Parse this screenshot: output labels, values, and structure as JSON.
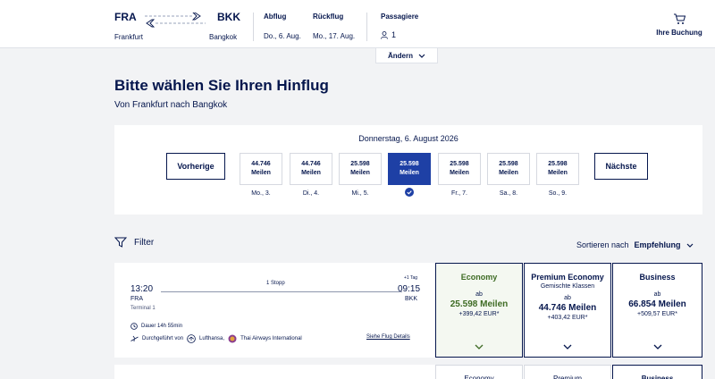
{
  "header": {
    "origin_code": "FRA",
    "origin_city": "Frankfurt",
    "destination_code": "BKK",
    "destination_city": "Bangkok",
    "outbound_label": "Abflug",
    "outbound_date": "Do., 6. Aug.",
    "return_label": "Rückflug",
    "return_date": "Mo., 17. Aug.",
    "passengers_label": "Passagiere",
    "passengers_count": "1",
    "booking_label": "Ihre Buchung",
    "change_label": "Ändern"
  },
  "page": {
    "title": "Bitte wählen Sie Ihren Hinflug",
    "subtitle": "Von Frankfurt nach Bangkok"
  },
  "date_selector": {
    "heading": "Donnerstag, 6. August 2026",
    "prev_label": "Vorherige",
    "next_label": "Nächste",
    "days": [
      {
        "amount": "44.746",
        "unit": "Meilen",
        "label": "Mo., 3."
      },
      {
        "amount": "44.746",
        "unit": "Meilen",
        "label": "Di., 4."
      },
      {
        "amount": "25.598",
        "unit": "Meilen",
        "label": "Mi., 5."
      },
      {
        "amount": "25.598",
        "unit": "Meilen",
        "label": "",
        "selected": true
      },
      {
        "amount": "25.598",
        "unit": "Meilen",
        "label": "Fr., 7."
      },
      {
        "amount": "25.598",
        "unit": "Meilen",
        "label": "Sa., 8."
      },
      {
        "amount": "25.598",
        "unit": "Meilen",
        "label": "So., 9."
      }
    ]
  },
  "toolbar": {
    "filter_label": "Filter",
    "sort_label": "Sortieren nach",
    "sort_value": "Empfehlung"
  },
  "flight": {
    "departure_time": "13:20",
    "departure_code": "FRA",
    "departure_terminal": "Terminal 1",
    "stops": "1 Stopp",
    "day_offset": "+1 Tag",
    "arrival_time": "09:15",
    "arrival_code": "BKK",
    "duration": "Dauer 14h 55min",
    "operated_by_label": "Durchgeführt von",
    "airline_1": "Lufthansa,",
    "airline_2": "Thai Airways International",
    "details_link": "Siehe Flug Details",
    "fares": {
      "economy": {
        "title": "Economy",
        "prefix": "ab",
        "miles": "25.598 Meilen",
        "eur": "+399,42 EUR*"
      },
      "premium": {
        "title": "Premium Economy",
        "subtitle": "Gemischte Klassen",
        "prefix": "ab",
        "miles": "44.746 Meilen",
        "eur": "+403,42 EUR*"
      },
      "business": {
        "title": "Business",
        "prefix": "ab",
        "miles": "66.854 Meilen",
        "eur": "+509,57 EUR*"
      }
    }
  },
  "next_flight": {
    "economy_title": "Economy",
    "premium_title": "Premium",
    "business_title": "Business"
  },
  "colors": {
    "navy": "#05164d",
    "selected_blue": "#1e40a5",
    "economy_green": "#3e6b24"
  }
}
